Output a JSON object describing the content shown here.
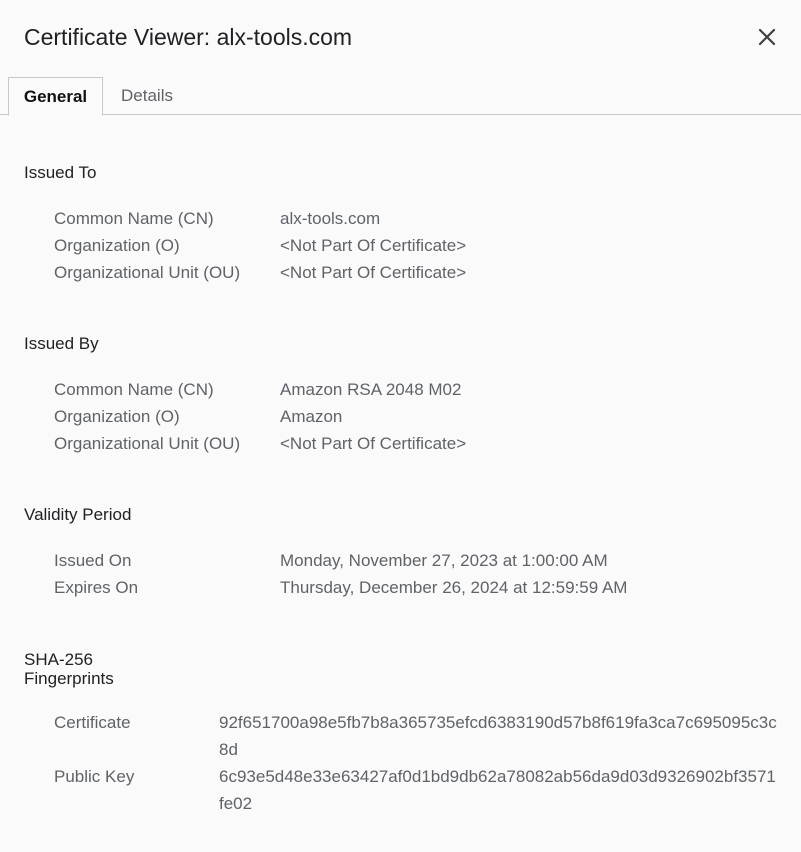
{
  "dialog": {
    "title": "Certificate Viewer: alx-tools.com"
  },
  "tabs": [
    {
      "label": "General",
      "active": true
    },
    {
      "label": "Details",
      "active": false
    }
  ],
  "issued_to": {
    "heading": "Issued To",
    "rows": [
      {
        "label": "Common Name (CN)",
        "value": "alx-tools.com"
      },
      {
        "label": "Organization (O)",
        "value": "<Not Part Of Certificate>"
      },
      {
        "label": "Organizational Unit (OU)",
        "value": "<Not Part Of Certificate>"
      }
    ]
  },
  "issued_by": {
    "heading": "Issued By",
    "rows": [
      {
        "label": "Common Name (CN)",
        "value": "Amazon RSA 2048 M02"
      },
      {
        "label": "Organization (O)",
        "value": "Amazon"
      },
      {
        "label": "Organizational Unit (OU)",
        "value": "<Not Part Of Certificate>"
      }
    ]
  },
  "validity": {
    "heading": "Validity Period",
    "rows": [
      {
        "label": "Issued On",
        "value": "Monday, November 27, 2023 at 1:00:00 AM"
      },
      {
        "label": "Expires On",
        "value": "Thursday, December 26, 2024 at 12:59:59 AM"
      }
    ]
  },
  "fingerprints": {
    "heading_line1": "SHA-256",
    "heading_line2": "Fingerprints",
    "rows": [
      {
        "label": "Certificate",
        "value": "92f651700a98e5fb7b8a365735efcd6383190d57b8f619fa3ca7c695095c3c8d"
      },
      {
        "label": "Public Key",
        "value": "6c93e5d48e33e63427af0d1bd9db62a78082ab56da9d03d9326902bf3571fe02"
      }
    ]
  }
}
